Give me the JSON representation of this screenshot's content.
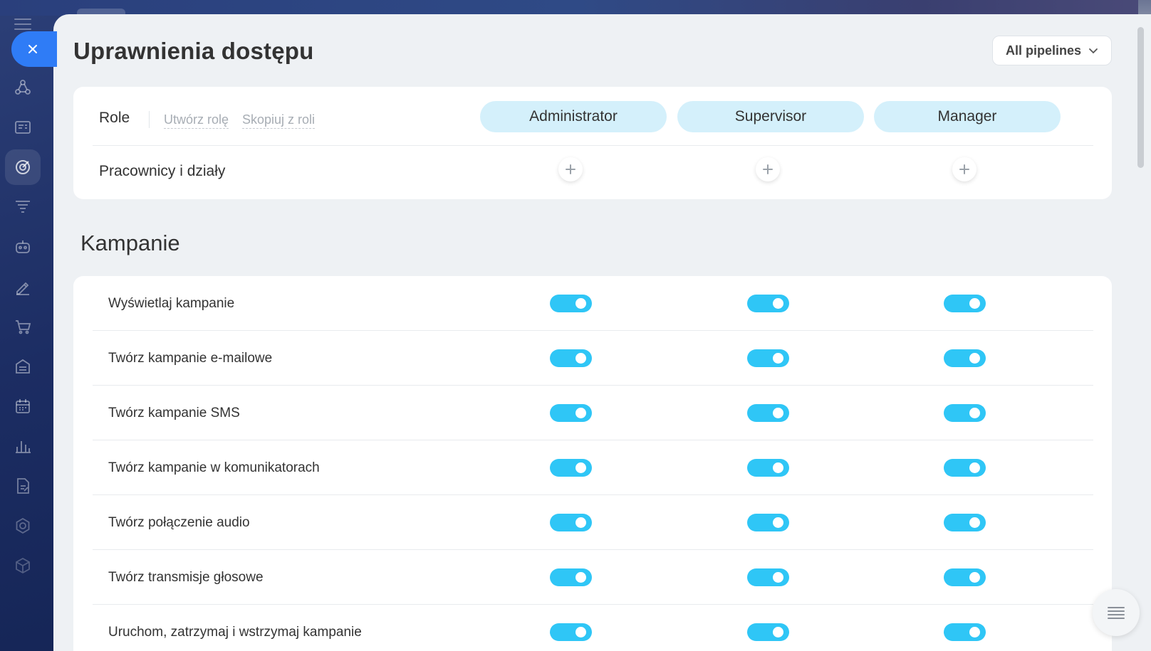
{
  "page": {
    "title": "Uprawnienia dostępu",
    "pipeline_select": "All pipelines"
  },
  "roles": {
    "label": "Role",
    "create_link": "Utwórz rolę",
    "copy_link": "Skopiuj z roli",
    "columns": [
      "Administrator",
      "Supervisor",
      "Manager"
    ],
    "staff_label": "Pracownicy i działy"
  },
  "section": {
    "title": "Kampanie",
    "permissions": [
      {
        "label": "Wyświetlaj kampanie",
        "values": [
          true,
          true,
          true
        ]
      },
      {
        "label": "Twórz kampanie e-mailowe",
        "values": [
          true,
          true,
          true
        ]
      },
      {
        "label": "Twórz kampanie SMS",
        "values": [
          true,
          true,
          true
        ]
      },
      {
        "label": "Twórz kampanie w komunikatorach",
        "values": [
          true,
          true,
          true
        ]
      },
      {
        "label": "Twórz połączenie audio",
        "values": [
          true,
          true,
          true
        ]
      },
      {
        "label": "Twórz transmisje głosowe",
        "values": [
          true,
          true,
          true
        ]
      },
      {
        "label": "Uruchom, zatrzymaj i wstrzymaj kampanie",
        "values": [
          true,
          true,
          true
        ]
      }
    ]
  },
  "sidebar": {
    "icons": [
      "crm-icon",
      "contact-center-icon",
      "marketing-icon",
      "sales-funnel-icon",
      "robot-icon",
      "signing-icon",
      "shop-icon",
      "inventory-icon",
      "calendar-icon",
      "analytics-icon",
      "documents-icon",
      "settings-icon",
      "box-icon"
    ],
    "active_index": 2
  },
  "colors": {
    "accent": "#2fc6f6",
    "role_pill": "#d4f0fb",
    "close_button": "#2f7cf6"
  }
}
